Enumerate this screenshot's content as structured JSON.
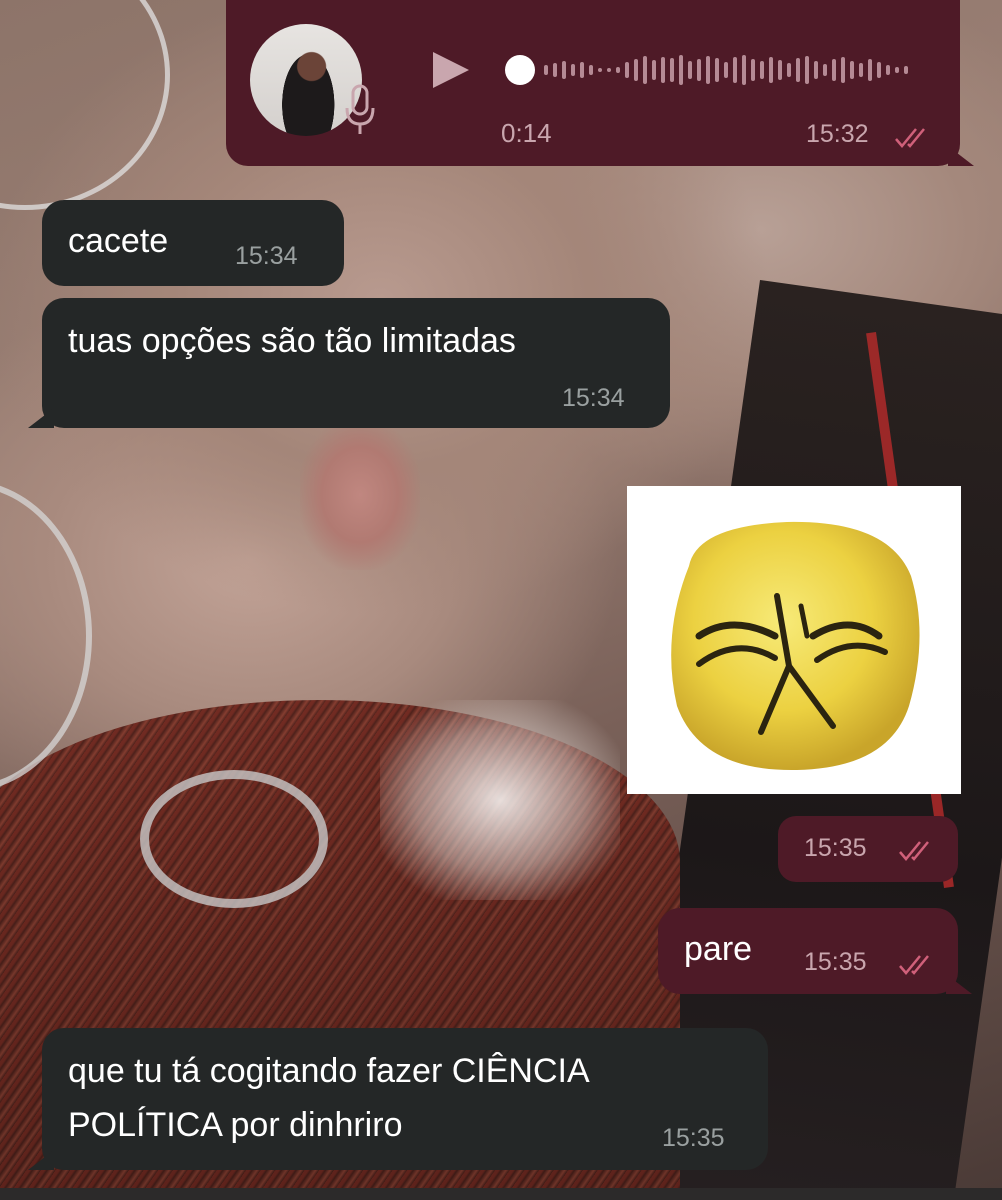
{
  "chat": {
    "messages": [
      {
        "id": "voice",
        "direction": "outgoing",
        "type": "voice",
        "duration": "0:14",
        "time": "15:32",
        "status": "read"
      },
      {
        "id": "m1",
        "direction": "incoming",
        "type": "text",
        "text": "cacete",
        "time": "15:34"
      },
      {
        "id": "m2",
        "direction": "incoming",
        "type": "text",
        "text": "tuas opções são tão limitadas",
        "time": "15:34"
      },
      {
        "id": "sticker",
        "direction": "outgoing",
        "type": "sticker",
        "sticker": "angry-yellow-face",
        "time": "15:35",
        "status": "read"
      },
      {
        "id": "m3",
        "direction": "outgoing",
        "type": "text",
        "text": "pare",
        "time": "15:35",
        "status": "read"
      },
      {
        "id": "m4",
        "direction": "incoming",
        "type": "text",
        "text": "que tu tá cogitando fazer CIÊNCIA\nPOLÍTICA por dinhriro",
        "time": "15:35"
      }
    ]
  },
  "icons": {
    "play": "play-icon",
    "mic": "microphone-icon",
    "ticks": "double-check-icon"
  },
  "colors": {
    "incoming_bubble": "#242727",
    "outgoing_bubble": "#4e1a27",
    "incoming_time": "#9aa0a0",
    "outgoing_time": "#c9a6ae",
    "read_ticks": "#d0607a"
  }
}
